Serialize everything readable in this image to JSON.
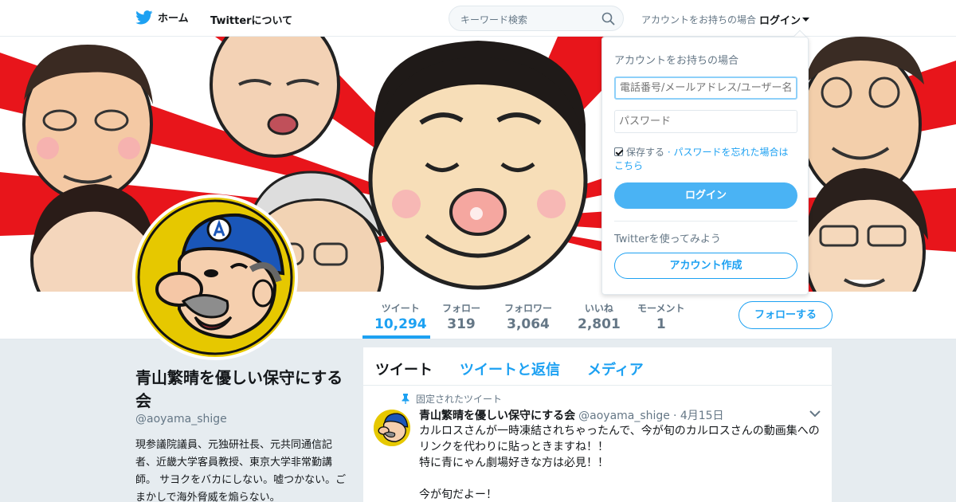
{
  "nav": {
    "home_label": "ホーム",
    "about_label": "Twitterについて",
    "search_placeholder": "キーワード検索",
    "have_account_text": "アカウントをお持ちの場合",
    "login_label": "ログイン"
  },
  "profile": {
    "name": "青山繁晴を優しい保守にする会",
    "handle": "@aoyama_shige",
    "bio": "現参議院議員、元独研社長、元共同通信記者、近畿大学客員教授、東京大学非常勤講師。 サヨクをバカにしない。嘘つかない。ごまかしで海外脅威を煽らない。",
    "follow_label": "フォローする"
  },
  "stats": [
    {
      "label": "ツイート",
      "value": "10,294",
      "active": true
    },
    {
      "label": "フォロー",
      "value": "319",
      "active": false
    },
    {
      "label": "フォロワー",
      "value": "3,064",
      "active": false
    },
    {
      "label": "いいね",
      "value": "2,801",
      "active": false
    },
    {
      "label": "モーメント",
      "value": "1",
      "active": false
    }
  ],
  "timeline": {
    "tabs": [
      "ツイート",
      "ツイートと返信",
      "メディア"
    ],
    "pinned_label": "固定されたツイート",
    "tweet": {
      "name": "青山繁晴を優しい保守にする会",
      "handle": "@aoyama_shige",
      "date": "· 4月15日",
      "lines": [
        "カルロスさんが一時凍結されちゃったんで、今が旬のカルロスさんの動画集へのリンクを代わりに貼っときますね！！",
        "特に青にゃん劇場好きな方は必見！！",
        "",
        "今が旬だよー！"
      ]
    }
  },
  "login_dropdown": {
    "title": "アカウントをお持ちの場合",
    "username_placeholder": "電話番号/メールアドレス/ユーザー名",
    "password_placeholder": "パスワード",
    "remember_label": "保存する",
    "forgot_label": "· パスワードを忘れた場合はこちら",
    "remember_checked": true,
    "login_button": "ログイン",
    "try_label": "Twitterを使ってみよう",
    "signup_button": "アカウント作成"
  },
  "colors": {
    "accent": "#1da1f2",
    "banner_red": "#e8151b",
    "avatar_yellow": "#e6c800",
    "cap_blue": "#1a56b8"
  }
}
